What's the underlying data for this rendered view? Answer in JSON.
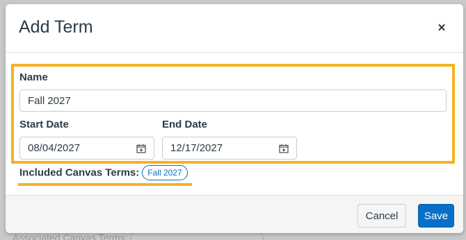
{
  "backdrop": {
    "label": "Associated Canvas Terms:"
  },
  "modal": {
    "title": "Add Term",
    "close_label": "×"
  },
  "form": {
    "name_label": "Name",
    "name_value": "Fall 2027",
    "start_date_label": "Start Date",
    "start_date_value": "08/04/2027",
    "end_date_label": "End Date",
    "end_date_value": "12/17/2027",
    "included_label": "Included Canvas Terms:",
    "included_terms": [
      "Fall 2027"
    ]
  },
  "footer": {
    "cancel_label": "Cancel",
    "save_label": "Save"
  },
  "colors": {
    "highlight": "#f4b223",
    "primary": "#0770c6",
    "text": "#2d3b45"
  }
}
